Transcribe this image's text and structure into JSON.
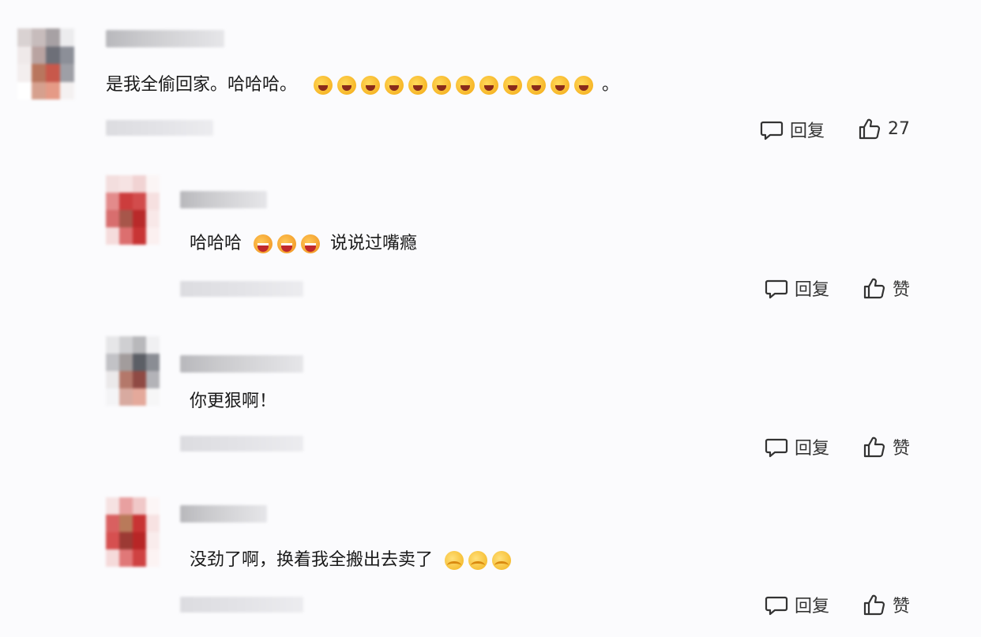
{
  "comments": [
    {
      "text": "是我全偷回家。哈哈哈。",
      "emojis": [
        "laugh",
        "laugh",
        "laugh",
        "laugh",
        "laugh",
        "laugh",
        "laugh",
        "laugh",
        "laugh",
        "laugh",
        "laugh",
        "laugh"
      ],
      "text_after": "。",
      "reply_label": "回复",
      "like_label": "27"
    },
    {
      "text": "哈哈哈",
      "emojis": [
        "grin",
        "grin",
        "grin"
      ],
      "text_after": "说说过嘴瘾",
      "reply_label": "回复",
      "like_label": "赞"
    },
    {
      "text": "你更狠啊！",
      "emojis": [],
      "text_after": "",
      "reply_label": "回复",
      "like_label": "赞"
    },
    {
      "text": "没劲了啊，换着我全搬出去卖了",
      "emojis": [
        "hug",
        "hug",
        "hug"
      ],
      "text_after": "",
      "reply_label": "回复",
      "like_label": "赞"
    }
  ],
  "icons": {
    "reply": "comment-bubble-icon",
    "like": "thumbs-up-icon"
  }
}
